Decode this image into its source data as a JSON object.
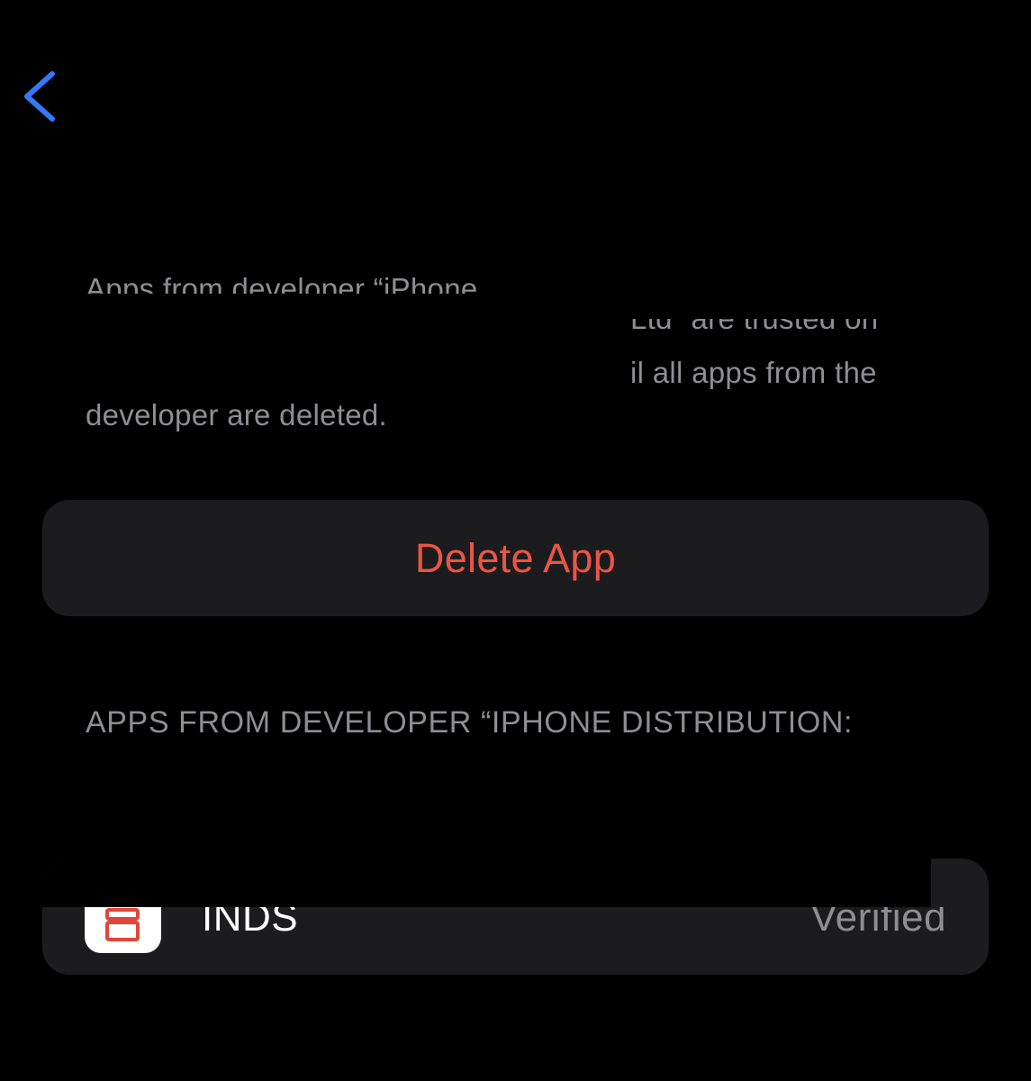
{
  "nav": {
    "back_icon": "chevron-left-icon",
    "accent_color": "#3478f6"
  },
  "description": {
    "line1": "Apps from developer “iPhone",
    "line2": "Ltd” are trusted on",
    "line3": "il all apps from the",
    "line4": "developer are deleted."
  },
  "delete_button": {
    "label": "Delete App",
    "color": "#eb5545"
  },
  "apps_section": {
    "header": "APPS FROM DEVELOPER “IPHONE DISTRIBUTION:",
    "apps": [
      {
        "name": "INDS",
        "status": "Verified",
        "icon": "app-icon"
      }
    ]
  }
}
